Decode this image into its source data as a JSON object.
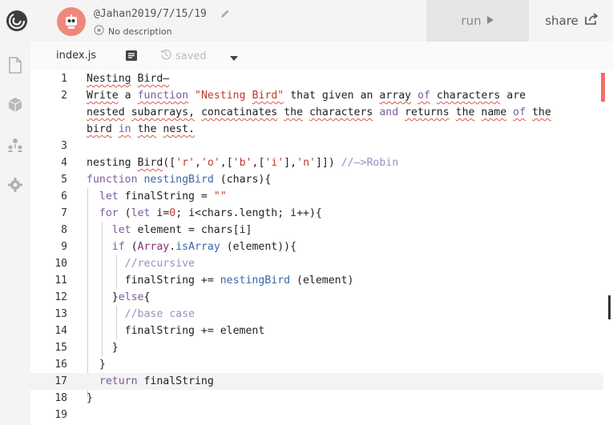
{
  "header": {
    "repl_title": "@Jahan2019/7/15/19",
    "description": "No description",
    "run_label": "run",
    "share_label": "share"
  },
  "tabs": {
    "file_name": "index.js",
    "saved_label": "saved"
  },
  "colors": {
    "header_bg": "#f4f4f4",
    "run_bg": "#e6e6e6",
    "avatar_bg": "#f0877a",
    "error_marker": "#f07060"
  },
  "icons": [
    "replit-logo-icon",
    "pencil-icon",
    "privacy-icon",
    "play-icon",
    "share-icon",
    "file-icon",
    "package-icon",
    "multiplayer-icon",
    "gear-icon",
    "format-icon",
    "history-icon",
    "chevron-down-icon"
  ],
  "editor": {
    "active_line": 17,
    "line_numbers": [
      "1",
      "2",
      "",
      "",
      "3",
      "4",
      "5",
      "6",
      "7",
      "8",
      "9",
      "10",
      "11",
      "12",
      "13",
      "14",
      "15",
      "16",
      "17",
      "18",
      "19"
    ],
    "lines": [
      "Nesting Bird–",
      "Write a function \"Nesting Bird\" that given an array of characters are",
      "nested subarrays, concatinates the characters and returns the name of the",
      "bird in the nest.",
      "",
      "nesting Bird(['r','o',['b',['i'],'n']]) //–>Robin",
      "function nestingBird (chars){",
      "  let finalString = \"\"",
      "  for (let i=0; i<chars.length; i++){",
      "    let element = chars[i]",
      "    if (Array.isArray (element)){",
      "      //recursive",
      "      finalString += nestingBird (element)",
      "    }else{",
      "      //base case",
      "      finalString += element",
      "    }",
      "  }",
      "  return finalString",
      "}",
      ""
    ]
  }
}
